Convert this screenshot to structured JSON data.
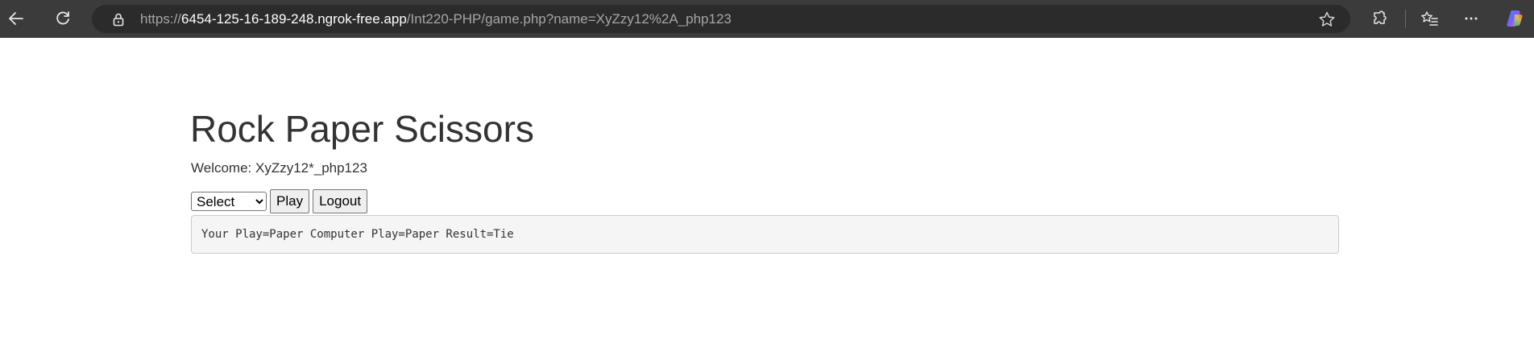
{
  "browser": {
    "url_scheme": "https://",
    "url_host": "6454-125-16-189-248.ngrok-free.app",
    "url_path": "/Int220-PHP/game.php?name=XyZzy12%2A_php123",
    "icons": {
      "back": "back-arrow-icon",
      "refresh": "refresh-icon",
      "lock": "lock-icon",
      "favorite": "star-icon",
      "extensions": "extensions-icon",
      "favorites_bar": "favorites-icon",
      "menu": "more-icon",
      "copilot": "copilot-icon"
    },
    "colors": {
      "toolbar": "#3b3b3b",
      "address_bar": "#2b2b2b"
    }
  },
  "page": {
    "title": "Rock Paper Scissors",
    "welcome": "Welcome: XyZzy12*_php123",
    "select": {
      "selected": "Select"
    },
    "play_label": "Play",
    "logout_label": "Logout",
    "result": "Your Play=Paper Computer Play=Paper Result=Tie"
  }
}
